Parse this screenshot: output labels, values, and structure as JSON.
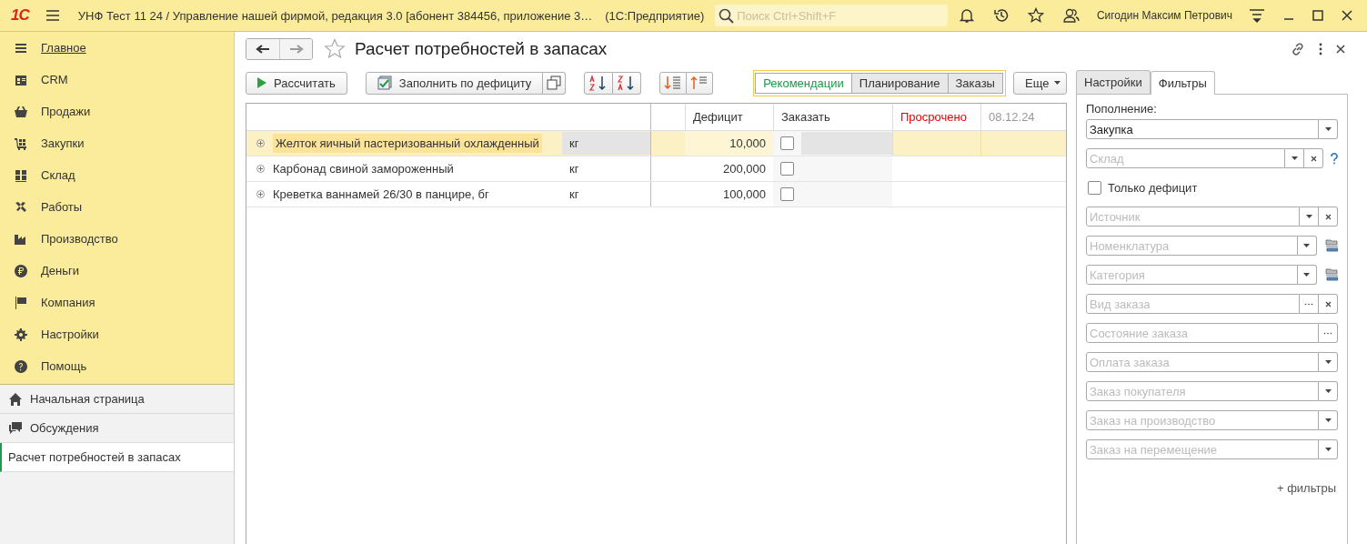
{
  "app_bar": {
    "logo": "1С",
    "title": "УНФ Тест 11 24 / Управление нашей фирмой, редакция 3.0 [абонент 384456, приложение 3…",
    "platform": "(1С:Предприятие)",
    "search_placeholder": "Поиск Ctrl+Shift+F",
    "user": "Сигодин Максим Петрович"
  },
  "sidebar": {
    "sections": [
      {
        "label": "Главное",
        "selected": true
      },
      {
        "label": "CRM",
        "selected": false
      },
      {
        "label": "Продажи",
        "selected": false
      },
      {
        "label": "Закупки",
        "selected": false
      },
      {
        "label": "Склад",
        "selected": false
      },
      {
        "label": "Работы",
        "selected": false
      },
      {
        "label": "Производство",
        "selected": false
      },
      {
        "label": "Деньги",
        "selected": false
      },
      {
        "label": "Компания",
        "selected": false
      },
      {
        "label": "Настройки",
        "selected": false
      },
      {
        "label": "Помощь",
        "selected": false
      }
    ],
    "open_windows": [
      {
        "label": "Начальная страница",
        "kind": "home",
        "selected": false
      },
      {
        "label": "Обсуждения",
        "kind": "discussions",
        "selected": false
      },
      {
        "label": "Расчет потребностей в запасах",
        "kind": "form",
        "selected": true
      }
    ]
  },
  "form": {
    "title": "Расчет потребностей в запасах",
    "calculate_button": "Рассчитать",
    "fill_button": "Заполнить по дефициту",
    "views": [
      {
        "label": "Рекомендации",
        "selected": true
      },
      {
        "label": "Планирование",
        "selected": false
      },
      {
        "label": "Заказы",
        "selected": false
      }
    ],
    "more_button": "Еще",
    "table": {
      "columns": [
        "Дефицит",
        "Заказать",
        "Просрочено",
        "08.12.24"
      ],
      "rows": [
        {
          "name": "Желток яичный пастеризованный охлажденный",
          "unit": "кг",
          "deficit": "10,000",
          "order": false,
          "selected": true
        },
        {
          "name": "Карбонад свиной замороженный",
          "unit": "кг",
          "deficit": "200,000",
          "order": false,
          "selected": false
        },
        {
          "name": "Креветка ваннамей 26/30 в панцире, бг",
          "unit": "кг",
          "deficit": "100,000",
          "order": false,
          "selected": false
        }
      ]
    }
  },
  "filter_panel": {
    "tabs": [
      {
        "label": "Настройки",
        "selected": false
      },
      {
        "label": "Фильтры",
        "selected": true
      }
    ],
    "replenishment_label": "Пополнение:",
    "fields": [
      {
        "kind": "field",
        "value": "Закупка",
        "dropdown": true
      },
      {
        "kind": "field",
        "placeholder": "Склад",
        "dropdown": true,
        "clear": true,
        "help": true
      },
      {
        "kind": "checkbox",
        "label": "Только дефицит",
        "checked": false
      },
      {
        "kind": "field",
        "placeholder": "Источник",
        "dropdown": true,
        "clear": true
      },
      {
        "kind": "field",
        "placeholder": "Номенклатура",
        "dropdown": true,
        "picker": true
      },
      {
        "kind": "field",
        "placeholder": "Категория",
        "dropdown": true,
        "picker": true
      },
      {
        "kind": "field",
        "placeholder": "Вид заказа",
        "select": true,
        "clear": true
      },
      {
        "kind": "field",
        "placeholder": "Состояние заказа",
        "select": true
      },
      {
        "kind": "field",
        "placeholder": "Оплата заказа",
        "dropdown": true
      },
      {
        "kind": "field",
        "placeholder": "Заказ покупателя",
        "dropdown": true
      },
      {
        "kind": "field",
        "placeholder": "Заказ на производство",
        "dropdown": true
      },
      {
        "kind": "field",
        "placeholder": "Заказ на перемещение",
        "dropdown": true
      }
    ],
    "add_filters_link": "+ фильтры"
  }
}
